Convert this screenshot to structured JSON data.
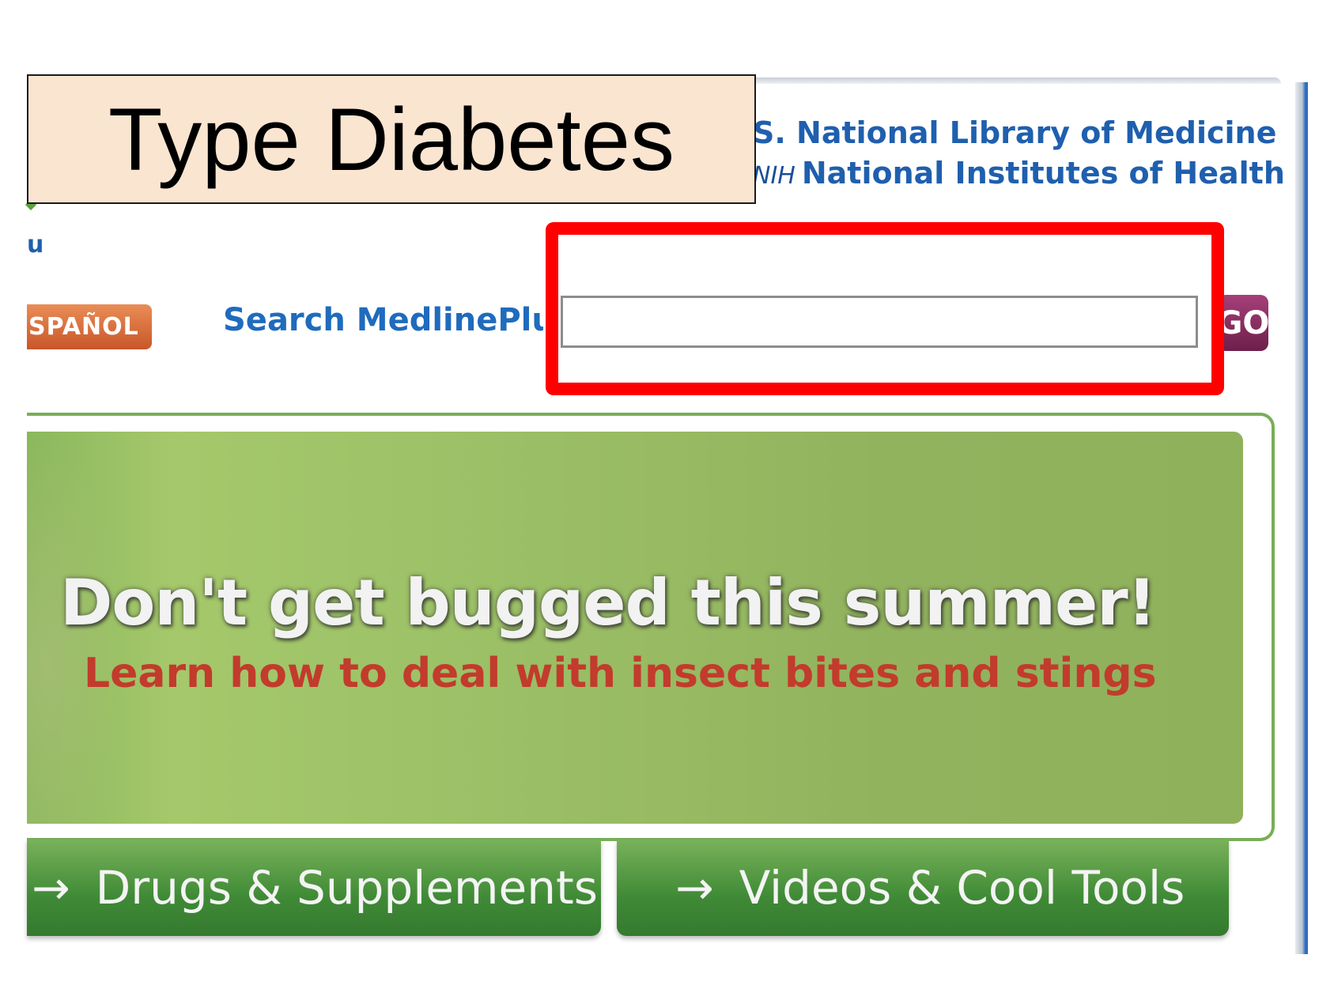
{
  "slide": {
    "title": "Type Diabetes"
  },
  "header": {
    "nlm_line": "S. National Library of Medicine",
    "nih_mark": "NIH",
    "nih_line": "National Institutes of Health",
    "nav_fragment": "u"
  },
  "toolbar": {
    "espanol_label": "SPAÑOL",
    "search_label": "Search MedlinePlus",
    "search_value": "",
    "go_label": "GO"
  },
  "banner": {
    "headline": "Don't get bugged this summer!",
    "subline": "Learn how to deal with insect bites and stings"
  },
  "tabs": [
    {
      "arrow": "→",
      "label": "Drugs & Supplements"
    },
    {
      "arrow": "→",
      "label": "Videos & Cool Tools"
    }
  ],
  "colors": {
    "highlight": "#ff0000",
    "link_blue": "#1f5fae",
    "banner_green": "#9cc167",
    "tab_green": "#3f8a36",
    "banner_subtext": "#c23b2c",
    "title_bg": "#fae5d1"
  }
}
